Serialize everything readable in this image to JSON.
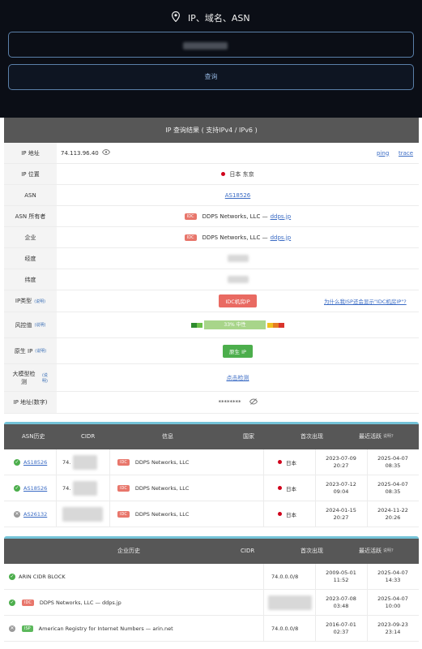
{
  "header": {
    "title": "IP、域名、ASN",
    "query_button": "查询"
  },
  "result": {
    "title": "IP 查询结果 ( 支持IPv4 / IPv6 )",
    "rows": {
      "ip": {
        "label": "IP 地址",
        "value": "74.113.96.40",
        "ping": "ping",
        "trace": "trace"
      },
      "location": {
        "label": "IP 位置",
        "value": "日本 东京"
      },
      "asn": {
        "label": "ASN",
        "value": "AS18526"
      },
      "asn_owner": {
        "label": "ASN 所有者",
        "tag": "IDC",
        "name": "DDPS Networks, LLC —",
        "domain": "ddps.jp"
      },
      "company": {
        "label": "企业",
        "tag": "IDC",
        "name": "DDPS Networks, LLC —",
        "domain": "ddps.jp"
      },
      "longitude": {
        "label": "经度"
      },
      "latitude": {
        "label": "纬度"
      },
      "ip_type": {
        "label": "IP类型",
        "hint": "(说明)",
        "value": "IDC机房IP",
        "question": "为什么我ISP还会显示\"IDC机房IP\"?"
      },
      "risk": {
        "label": "风控值",
        "hint": "(说明)",
        "value": "33% 中性",
        "percent": 33
      },
      "native": {
        "label": "原生 IP",
        "hint": "(说明)",
        "value": "原生 IP"
      },
      "llm": {
        "label": "大模型检测",
        "hint": "(说明)",
        "value": "点击检测"
      },
      "ip_num": {
        "label": "IP 地址(数字)",
        "value": "********"
      }
    }
  },
  "asn_history": {
    "headers": {
      "asn": "ASN历史",
      "cidr": "CIDR",
      "info": "信息",
      "country": "国家",
      "first_seen": "首次出现",
      "last_active": "最近活跃",
      "hint": "说明?"
    },
    "rows": [
      {
        "status": "ok",
        "asn": "AS18526",
        "cidr": "74.",
        "tag": "IDC",
        "info": "DDPS Networks, LLC",
        "country": "日本",
        "first_date": "2023-07-09",
        "first_time": "20:27",
        "last_date": "2025-04-07",
        "last_time": "08:35"
      },
      {
        "status": "ok",
        "asn": "AS18526",
        "cidr": "74.",
        "tag": "IDC",
        "info": "DDPS Networks, LLC",
        "country": "日本",
        "first_date": "2023-07-12",
        "first_time": "09:04",
        "last_date": "2025-04-07",
        "last_time": "08:35"
      },
      {
        "status": "x",
        "asn": "AS26132",
        "cidr": "",
        "tag": "IDC",
        "info": "DDPS Networks, LLC",
        "country": "日本",
        "first_date": "2024-01-15",
        "first_time": "20:27",
        "last_date": "2024-11-22",
        "last_time": "20:26"
      }
    ]
  },
  "corp_history": {
    "headers": {
      "corp": "企业历史",
      "cidr": "CIDR",
      "first_seen": "首次出现",
      "last_active": "最近活跃",
      "hint": "说明?"
    },
    "rows": [
      {
        "status": "ok",
        "tag": "",
        "name": "ARIN CIDR BLOCK",
        "cidr": "74.0.0.0/8",
        "first_date": "2009-05-01",
        "first_time": "11:52",
        "last_date": "2025-04-07",
        "last_time": "14:33"
      },
      {
        "status": "ok",
        "tag": "IDC",
        "name": "DDPS Networks, LLC — ddps.jp",
        "cidr": "",
        "first_date": "2023-07-08",
        "first_time": "03:48",
        "last_date": "2025-04-07",
        "last_time": "10:00"
      },
      {
        "status": "x",
        "tag": "ISP",
        "name": "American Registry for Internet Numbers — arin.net",
        "cidr": "74.0.0.0/8",
        "first_date": "2016-07-01",
        "first_time": "02:37",
        "last_date": "2023-09-23",
        "last_time": "23:14"
      }
    ]
  }
}
